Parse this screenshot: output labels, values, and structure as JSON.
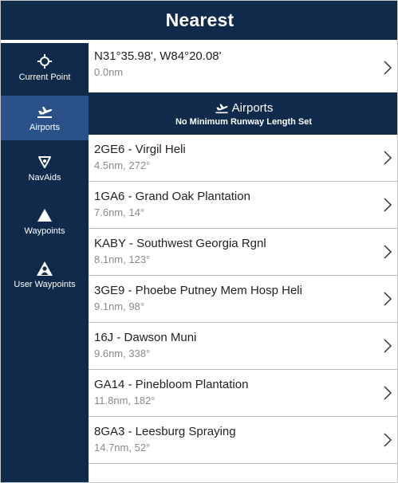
{
  "header": {
    "title": "Nearest"
  },
  "sidebar": {
    "items": [
      {
        "label": "Current Point",
        "icon": "crosshair-icon",
        "active": false
      },
      {
        "label": "Airports",
        "icon": "airplane-icon",
        "active": true
      },
      {
        "label": "NavAids",
        "icon": "navaid-icon",
        "active": false
      },
      {
        "label": "Waypoints",
        "icon": "triangle-icon",
        "active": false
      },
      {
        "label": "User Waypoints",
        "icon": "user-waypoint-icon",
        "active": false
      }
    ]
  },
  "current_point": {
    "coords": "N31°35.98', W84°20.08'",
    "distance": "0.0nm"
  },
  "section": {
    "title": "Airports",
    "subtitle": "No Minimum Runway Length Set"
  },
  "airports": [
    {
      "name": "2GE6 - Virgil Heli",
      "detail": "4.5nm, 272°"
    },
    {
      "name": "1GA6 - Grand Oak Plantation",
      "detail": "7.6nm, 14°"
    },
    {
      "name": "KABY - Southwest Georgia Rgnl",
      "detail": "8.1nm, 123°"
    },
    {
      "name": "3GE9 - Phoebe Putney Mem Hosp Heli",
      "detail": "9.1nm, 98°"
    },
    {
      "name": "16J - Dawson Muni",
      "detail": "9.6nm, 338°"
    },
    {
      "name": "GA14 - Pinebloom Plantation",
      "detail": "11.8nm, 182°"
    },
    {
      "name": "8GA3 - Leesburg Spraying",
      "detail": "14.7nm, 52°"
    }
  ],
  "colors": {
    "navy": "#0f2a4a",
    "active": "#2a5288",
    "divider": "#b9b9b9",
    "subtext": "#8a8a8a"
  }
}
